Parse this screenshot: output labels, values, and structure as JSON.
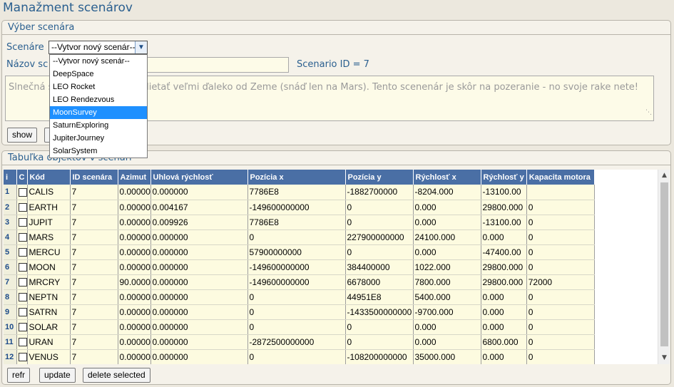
{
  "title": "Manažment scenárov",
  "select_panel": {
    "heading": "Výber scenára",
    "scenario_label": "Scenáre",
    "scenario_value": "--Vytvor nový scenár--",
    "name_label": "Názov sc",
    "scenario_id_text": "Scenario ID = 7",
    "description": "Slnečná s                               vám neodporúčam lietať veľmi ďaleko od Zeme (snáď len na Mars). Tento scenenár je skôr na pozeranie - no svoje rake                               nete!",
    "show_button": "show",
    "dropdown_options": [
      "--Vytvor nový scenár--",
      "DeepSpace",
      "LEO Rocket",
      "LEO Rendezvous",
      "MoonSurvey",
      "SaturnExploring",
      "JupiterJourney",
      "SolarSystem"
    ],
    "dropdown_selected": "MoonSurvey"
  },
  "table_panel": {
    "heading": "Tabuľka objektov v scenári",
    "columns": [
      "i",
      "C",
      "Kód",
      "ID scenára",
      "Azimut",
      "Uhlová rýchlosť",
      "Pozícia x",
      "Pozícia y",
      "Rýchlosť x",
      "Rýchlosť y",
      "Kapacita motora"
    ],
    "rows": [
      [
        "1",
        "CALIS",
        "7",
        "0.00000",
        "0.000000",
        "7786E8",
        "-1882700000",
        "-8204.000",
        "-13100.00",
        ""
      ],
      [
        "2",
        "EARTH",
        "7",
        "0.00000",
        "0.004167",
        "-149600000000",
        "0",
        "0.000",
        "29800.000",
        "0"
      ],
      [
        "3",
        "JUPIT",
        "7",
        "0.00000",
        "0.009926",
        "7786E8",
        "0",
        "0.000",
        "-13100.00",
        "0"
      ],
      [
        "4",
        "MARS",
        "7",
        "0.00000",
        "0.000000",
        "0",
        "227900000000",
        "24100.000",
        "0.000",
        "0"
      ],
      [
        "5",
        "MERCU",
        "7",
        "0.00000",
        "0.000000",
        "57900000000",
        "0",
        "0.000",
        "-47400.00",
        "0"
      ],
      [
        "6",
        "MOON",
        "7",
        "0.00000",
        "0.000000",
        "-149600000000",
        "384400000",
        "1022.000",
        "29800.000",
        "0"
      ],
      [
        "7",
        "MRCRY",
        "7",
        "90.0000",
        "0.000000",
        "-149600000000",
        "6678000",
        "7800.000",
        "29800.000",
        "72000"
      ],
      [
        "8",
        "NEPTN",
        "7",
        "0.00000",
        "0.000000",
        "0",
        "44951E8",
        "5400.000",
        "0.000",
        "0"
      ],
      [
        "9",
        "SATRN",
        "7",
        "0.00000",
        "0.000000",
        "0",
        "-1433500000000",
        "-9700.000",
        "0.000",
        "0"
      ],
      [
        "10",
        "SOLAR",
        "7",
        "0.00000",
        "0.000000",
        "0",
        "0",
        "0.000",
        "0.000",
        "0"
      ],
      [
        "11",
        "URAN",
        "7",
        "0.00000",
        "0.000000",
        "-2872500000000",
        "0",
        "0.000",
        "6800.000",
        "0"
      ],
      [
        "12",
        "VENUS",
        "7",
        "0.00000",
        "0.000000",
        "0",
        "-108200000000",
        "35000.000",
        "0.000",
        "0"
      ]
    ],
    "buttons": {
      "refresh": "refr",
      "update": "update",
      "delete": "delete selected"
    }
  },
  "icons": {
    "dropdown_arrow": "chevron-down-icon",
    "scroll_up": "arrow-up-icon",
    "scroll_down": "arrow-down-icon",
    "resize": "resize-grip-icon"
  },
  "colors": {
    "accent": "#2a5f8f",
    "table_header": "#4a6fa5",
    "selected_option": "#1e90ff",
    "cell_bg": "#fdfbe0"
  }
}
